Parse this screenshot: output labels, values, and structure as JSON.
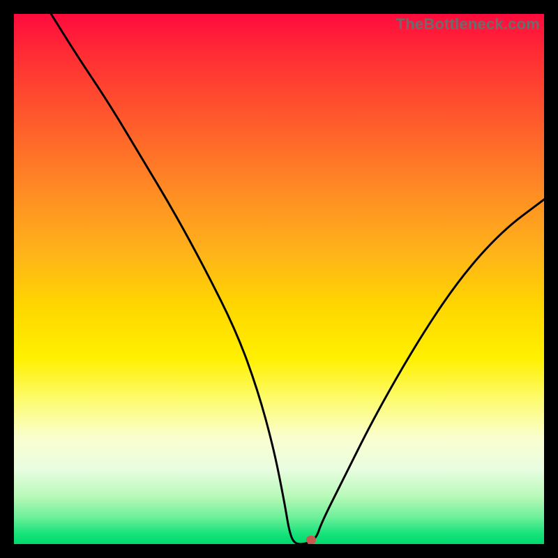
{
  "watermark": "TheBottleneck.com",
  "chart_data": {
    "type": "line",
    "title": "",
    "xlabel": "",
    "ylabel": "",
    "xlim": [
      0,
      100
    ],
    "ylim": [
      0,
      100
    ],
    "grid": false,
    "series": [
      {
        "name": "bottleneck-curve",
        "x": [
          7,
          12,
          18,
          24,
          30,
          36,
          42,
          46,
          49,
          51,
          52,
          53,
          55,
          57,
          58,
          62,
          68,
          76,
          84,
          92,
          100
        ],
        "values": [
          100,
          92,
          83,
          73,
          63,
          52,
          40,
          29,
          18,
          8,
          2,
          0,
          0,
          1,
          4,
          12,
          24,
          38,
          50,
          59,
          65
        ]
      },
      {
        "name": "marker-point",
        "x": [
          56
        ],
        "values": [
          0.8
        ]
      }
    ]
  },
  "colors": {
    "curve": "#000000",
    "marker": "#c7584f",
    "frame": "#000000"
  }
}
